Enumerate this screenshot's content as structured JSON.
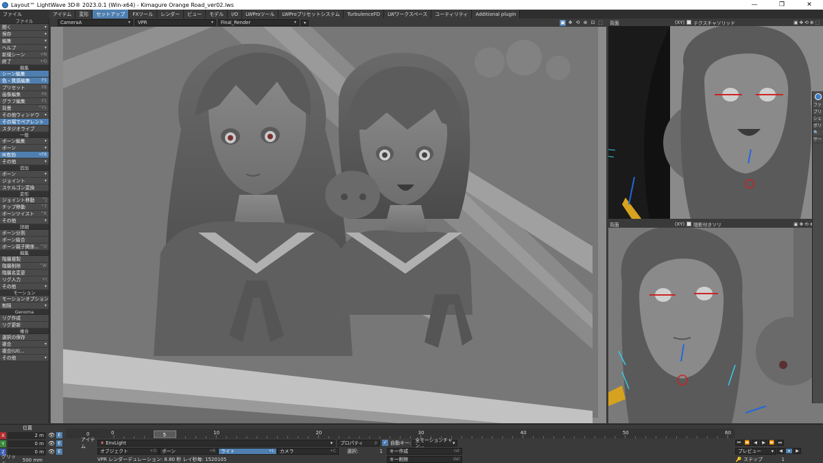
{
  "window": {
    "title": "Layout™ LightWave 3D® 2023.0.1 (Win-x64) - Kimagure Orange Road_ver02.lws",
    "controls": [
      "—",
      "❐",
      "✕"
    ]
  },
  "tabs": {
    "menu_label": "ファイル",
    "items": [
      "アイテム",
      "変形",
      "セットアップ",
      "FXツール",
      "レンダー",
      "ビュー",
      "モデル",
      "I/O",
      "LWProツール",
      "LWProプリセットシステム",
      "TurbulenceFD",
      "LWワークスペース",
      "ユーティリティ",
      "Additional plugin"
    ],
    "active_index": 2
  },
  "left_panel": {
    "sections": [
      {
        "header": "ファイル",
        "items": [
          {
            "label": "開く",
            "shortcut": "",
            "drop": true
          },
          {
            "label": "保存",
            "shortcut": "",
            "drop": true
          },
          {
            "label": "編集",
            "shortcut": "",
            "drop": true
          },
          {
            "label": "ヘルプ",
            "shortcut": "",
            "drop": true
          },
          {
            "label": "新規シーン",
            "shortcut": "+N"
          },
          {
            "label": "終了",
            "shortcut": "+Q"
          }
        ]
      },
      {
        "header": "編集",
        "items": [
          {
            "label": "シーン編集",
            "shortcut": "",
            "active": true
          },
          {
            "label": "色・質感編集",
            "shortcut": "F5",
            "active": true
          },
          {
            "label": "プリセット",
            "shortcut": "F8"
          },
          {
            "label": "画像編集",
            "shortcut": "F6"
          },
          {
            "label": "グラフ編集",
            "shortcut": "F1"
          },
          {
            "label": "背景",
            "shortcut": "^F5"
          },
          {
            "label": "その他ウィンドウ",
            "shortcut": "",
            "drop": true
          },
          {
            "label": "その場でペアレント",
            "shortcut": "",
            "active": true
          },
          {
            "label": "スタジオライブ",
            "shortcut": ""
          }
        ]
      },
      {
        "header": "一般",
        "items": [
          {
            "label": "ボーン編集",
            "shortcut": "",
            "drop": true
          },
          {
            "label": "ボーン",
            "shortcut": "",
            "drop": true
          },
          {
            "label": "IK有効",
            "shortcut": "+F8",
            "active": true
          },
          {
            "label": "その他",
            "shortcut": "",
            "drop": true
          }
        ]
      },
      {
        "header": "追加",
        "items": [
          {
            "label": "ボーン",
            "shortcut": "",
            "drop": true
          },
          {
            "label": "ジョイント",
            "shortcut": "",
            "drop": true
          },
          {
            "label": "スケルゴン変換",
            "shortcut": ""
          }
        ]
      },
      {
        "header": "変形",
        "items": [
          {
            "label": "ジョイント移動",
            "shortcut": "^J"
          },
          {
            "label": "チップ移動",
            "shortcut": "^T"
          },
          {
            "label": "ボーンツイスト",
            "shortcut": "^K"
          },
          {
            "label": "その他",
            "shortcut": "",
            "drop": true
          }
        ]
      },
      {
        "header": "詳細",
        "items": [
          {
            "label": "ボーン分割",
            "shortcut": ""
          },
          {
            "label": "ボーン結合",
            "shortcut": ""
          },
          {
            "label": "ボーン親子関係...",
            "shortcut": "^U"
          }
        ]
      },
      {
        "header": "編集",
        "items": [
          {
            "label": "階層複製",
            "shortcut": ""
          },
          {
            "label": "階層削除",
            "shortcut": "^W"
          },
          {
            "label": "階層名変更",
            "shortcut": ""
          },
          {
            "label": "リグ入力",
            "shortcut": "+I"
          },
          {
            "label": "その他",
            "shortcut": "",
            "drop": true
          }
        ]
      },
      {
        "header": "モーション",
        "items": [
          {
            "label": "モーションオプション",
            "shortcut": "B"
          },
          {
            "label": "制限",
            "shortcut": "",
            "drop": true
          }
        ]
      },
      {
        "header": "Genoma",
        "items": [
          {
            "label": "リグ作成",
            "shortcut": ""
          },
          {
            "label": "リグ更新",
            "shortcut": ""
          }
        ]
      },
      {
        "header": "複合",
        "items": [
          {
            "label": "選択の保存",
            "shortcut": ""
          },
          {
            "label": "複合",
            "shortcut": "",
            "drop": true
          },
          {
            "label": "複合(UI)...",
            "shortcut": ""
          },
          {
            "label": "その他",
            "shortcut": "",
            "drop": true
          }
        ]
      }
    ]
  },
  "main_viewport": {
    "camera": "CameraA",
    "view_mode": "VPR",
    "render_preset": "Final_Render"
  },
  "right_top_viewport": {
    "label": "背面",
    "axis": "(XY)",
    "mode": "テクスチャソリッド"
  },
  "right_bottom_viewport": {
    "label": "背面",
    "axis": "(XY)",
    "mode": "陰影付きソリ"
  },
  "float_panel": {
    "items": [
      "ファ",
      "プリ",
      "シェ",
      "ポリ",
      "🔍",
      "サー"
    ]
  },
  "coords": {
    "header": "位置",
    "rows": [
      {
        "axis": "X",
        "value": "2 m"
      },
      {
        "axis": "Y",
        "value": "0 m"
      },
      {
        "axis": "Z",
        "value": "0 m"
      }
    ],
    "grid_label": "グリッド",
    "grid_value": "500 mm"
  },
  "timeline": {
    "start": "0",
    "current_frame": "5",
    "tick_labels": [
      "0",
      "10",
      "20",
      "30",
      "40",
      "50",
      "60"
    ],
    "end": "60",
    "start_field": "0"
  },
  "bottom_controls": {
    "item_label": "アイテム",
    "item_value": "EnvLight",
    "object_btn": "オブジェクト",
    "object_sc": "+O",
    "bone_btn": "ボーン",
    "bone_sc": "+B",
    "light_btn": "ライト",
    "light_sc": "+L",
    "camera_btn": "カメラ",
    "camera_sc": "+C",
    "properties_btn": "プロパティ",
    "properties_sc": "p",
    "autokey_label": "自動キー:",
    "autokey_value": "全モーションチャン...",
    "select_label": "選択:",
    "select_value": "1",
    "create_key": "キー作成",
    "create_key_sc": "ret",
    "delete_key": "キー削除",
    "delete_key_sc": "del",
    "status_text": "VPR レンダーデュレーション: 8.80 秒  レイ秒毎: 1520105",
    "preview_label": "プレビュー",
    "step_label": "ステップ",
    "step_value": "1"
  },
  "colors": {
    "accent": "#4f7fb0",
    "panel": "#3c3c3c",
    "viewport_gray": "#7a7a7a"
  }
}
